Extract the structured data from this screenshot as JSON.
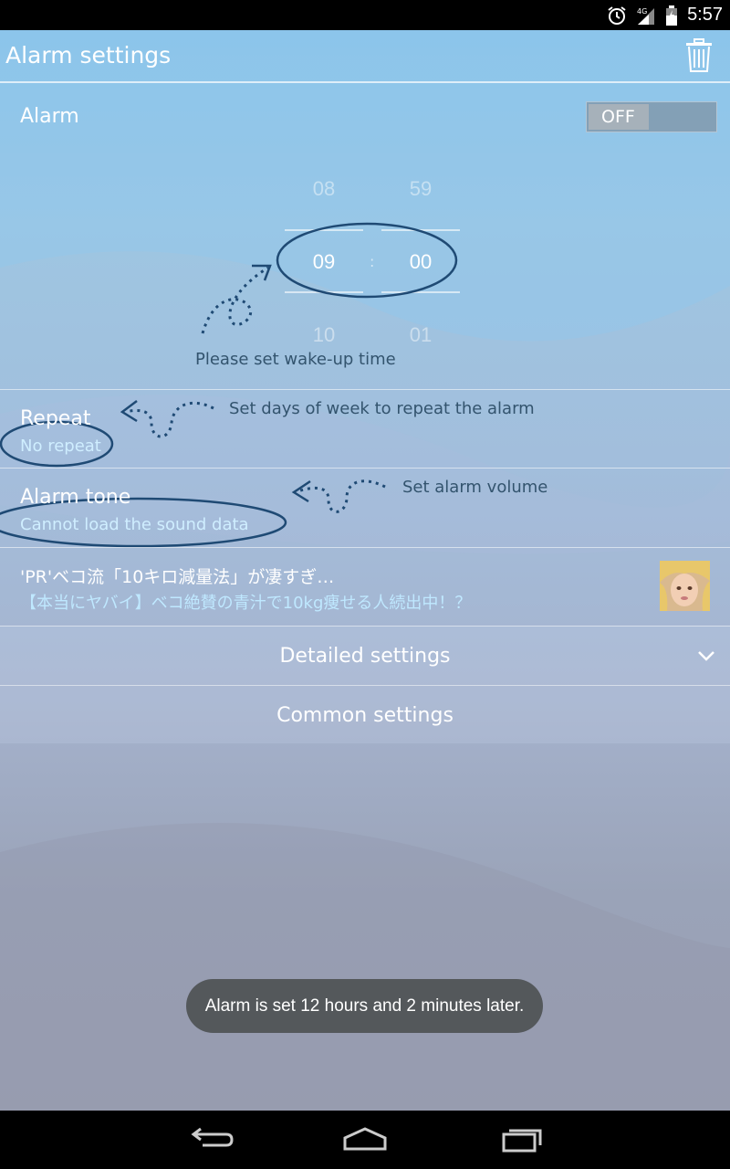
{
  "status_bar": {
    "time": "5:57",
    "icons": [
      "alarm-clock-icon",
      "signal-4g-icon",
      "battery-icon"
    ]
  },
  "app_bar": {
    "title": "Alarm settings",
    "delete_icon": "trash-icon"
  },
  "alarm": {
    "label": "Alarm",
    "toggle_label": "OFF"
  },
  "time_picker": {
    "hour_prev": "08",
    "hour": "09",
    "hour_next": "10",
    "minute_prev": "59",
    "minute": "00",
    "minute_next": "01",
    "separator": ":"
  },
  "hints": {
    "wake_up": "Please set wake-up time",
    "repeat": "Set days of week to repeat the alarm",
    "volume": "Set alarm volume"
  },
  "repeat": {
    "title": "Repeat",
    "value": "No repeat"
  },
  "alarm_tone": {
    "title": "Alarm tone",
    "value": "Cannot load the sound data"
  },
  "ad": {
    "title": "'PR'ベコ流「10キロ減量法」が凄すぎ…",
    "subtitle": "【本当にヤバイ】ベコ絶賛の青汁で10kg痩せる人続出中！？"
  },
  "sections": {
    "detailed": "Detailed settings",
    "common": "Common settings"
  },
  "toast": {
    "message": "Alarm is set 12 hours and 2 minutes later."
  },
  "nav_bar": {
    "icons": [
      "back-icon",
      "home-icon",
      "recent-apps-icon"
    ]
  },
  "colors": {
    "annotation": "#1f4a74",
    "subtext": "#cfeeff"
  }
}
